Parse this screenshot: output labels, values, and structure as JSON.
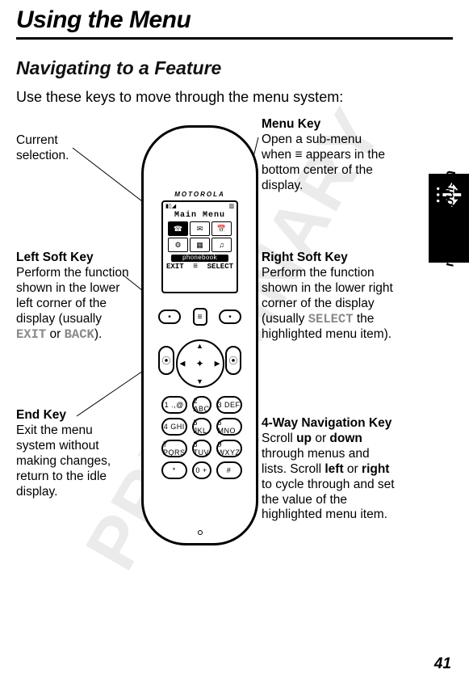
{
  "page": {
    "title": "Using the Menu",
    "subtitle": "Navigating to a Feature",
    "intro": "Use these keys to move through the menu system:",
    "number": "41",
    "section_label": "Using the Menu",
    "watermark": "PRELIMINARY"
  },
  "phone": {
    "brand": "MOTOROLA",
    "screen": {
      "menu_title": "Main Menu",
      "hint": "phonebook",
      "soft_left": "EXIT",
      "soft_right": "SELECT",
      "menu_glyph": "≡"
    },
    "keypad": [
      "1 .,@",
      "2 ABC",
      "3 DEF",
      "4 GHI",
      "5 JKL",
      "6 MNO",
      "7 PQRS",
      "8 TUV",
      "9 WXYZ",
      "*",
      "0 +",
      "#"
    ]
  },
  "callouts": {
    "current": {
      "head": "",
      "body": "Current selection."
    },
    "leftsoft": {
      "head": "Left Soft Key",
      "body_pre": "Perform the function shown in the lower left corner of the display (usually ",
      "code1": "EXIT",
      "mid": " or ",
      "code2": "BACK",
      "body_post": ")."
    },
    "end": {
      "head": "End Key",
      "body": "Exit the menu system without making changes, return to the idle display."
    },
    "menu": {
      "head": "Menu Key",
      "body_pre": "Open a sub-menu when ",
      "glyph": "≡",
      "body_post": " appears in the bottom center of the display."
    },
    "rightsoft": {
      "head": "Right Soft Key",
      "body_pre": "Perform the function shown in the lower right corner of the display (usually ",
      "code1": "SELECT",
      "body_post": " the highlighted menu item)."
    },
    "fourway": {
      "head": "4-Way Navigation Key",
      "body": "Scroll up or down through menus and lists. Scroll left or right to cycle through and set the value of the highlighted menu item."
    }
  }
}
